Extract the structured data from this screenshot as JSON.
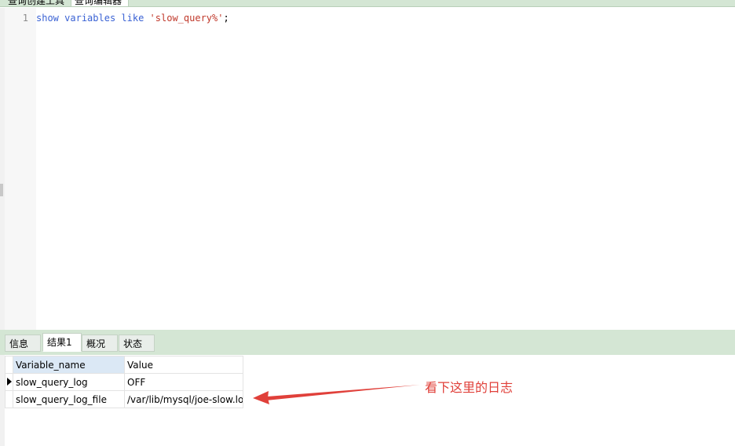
{
  "editor_tabs": [
    {
      "label": "查询创建工具",
      "active": false
    },
    {
      "label": "查询编辑器",
      "active": true
    }
  ],
  "editor": {
    "line_numbers": [
      "1"
    ],
    "code_tokens": {
      "kw1": "show",
      "kw2": "variables",
      "kw3": "like",
      "str": "'slow_query%'",
      "end": ";"
    }
  },
  "result_tabs": [
    {
      "label": "信息",
      "active": false
    },
    {
      "label": "结果1",
      "active": true
    },
    {
      "label": "概况",
      "active": false
    },
    {
      "label": "状态",
      "active": false
    }
  ],
  "result_table": {
    "columns": [
      "Variable_name",
      "Value"
    ],
    "rows": [
      [
        "slow_query_log",
        "OFF"
      ],
      [
        "slow_query_log_file",
        "/var/lib/mysql/joe-slow.lo"
      ]
    ]
  },
  "annotation": {
    "text": "看下这里的日志",
    "color": "#e0403a"
  },
  "colors": {
    "keyword": "#3a62d4",
    "string": "#c0392b",
    "panel_green": "#d4e6d4",
    "header_blue": "#dbe8f5"
  }
}
